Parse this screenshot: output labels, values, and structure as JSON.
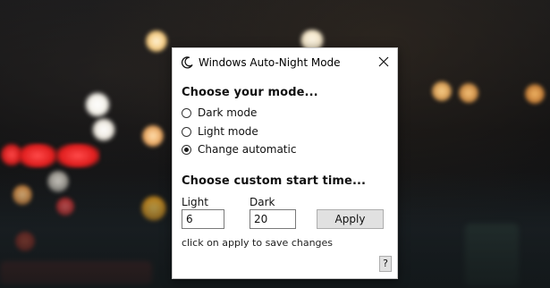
{
  "window": {
    "title": "Windows Auto-Night Mode",
    "icon": "crescent-moon-icon",
    "close_icon": "close-icon"
  },
  "mode": {
    "heading": "Choose your mode...",
    "options": [
      {
        "label": "Dark mode",
        "selected": false
      },
      {
        "label": "Light mode",
        "selected": false
      },
      {
        "label": "Change automatic",
        "selected": true
      }
    ]
  },
  "schedule": {
    "heading": "Choose custom start time...",
    "light_label": "Light",
    "light_value": "6",
    "dark_label": "Dark",
    "dark_value": "20",
    "apply_label": "Apply",
    "hint": "click on apply to save changes",
    "help_label": "?"
  }
}
